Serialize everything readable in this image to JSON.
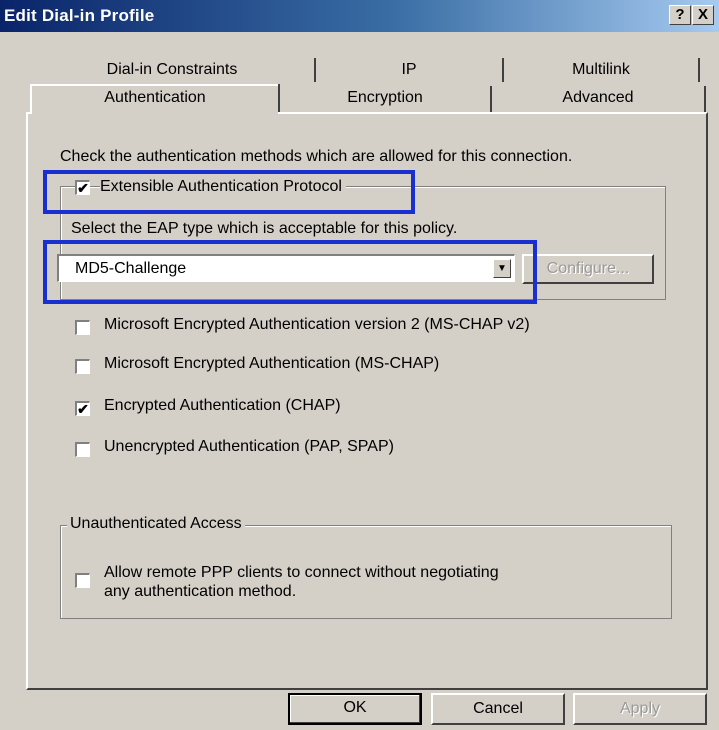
{
  "window": {
    "title": "Edit Dial-in Profile",
    "help_glyph": "?",
    "close_glyph": "X"
  },
  "tabs": {
    "row_back": [
      "Dial-in Constraints",
      "IP",
      "Multilink"
    ],
    "row_front": [
      "Authentication",
      "Encryption",
      "Advanced"
    ],
    "selected": "Authentication"
  },
  "panel": {
    "intro": "Check the authentication methods which are allowed for this connection.",
    "eap": {
      "label": "Extensible Authentication Protocol",
      "checked": true,
      "check_glyph": "✔",
      "prompt": "Select the EAP type which is acceptable for this policy.",
      "selected_type": "MD5-Challenge",
      "dropdown_glyph": "▼",
      "configure_label": "Configure..."
    },
    "methods": [
      {
        "label": "Microsoft Encrypted Authentication version 2 (MS-CHAP v2)",
        "checked": false
      },
      {
        "label": "Microsoft Encrypted Authentication (MS-CHAP)",
        "checked": false
      },
      {
        "label": "Encrypted Authentication (CHAP)",
        "checked": true,
        "check_glyph": "✔"
      },
      {
        "label": "Unencrypted Authentication (PAP, SPAP)",
        "checked": false
      }
    ],
    "unauth": {
      "title": "Unauthenticated Access",
      "line1": "Allow remote PPP clients to connect without negotiating",
      "line2": "any authentication method.",
      "checked": false
    }
  },
  "buttons": {
    "ok": "OK",
    "cancel": "Cancel",
    "apply": "Apply"
  },
  "colors": {
    "titlebar_start": "#0a246a",
    "titlebar_end": "#a6caf0",
    "face": "#d4d0c8",
    "highlight_box": "#1a2fd0"
  }
}
